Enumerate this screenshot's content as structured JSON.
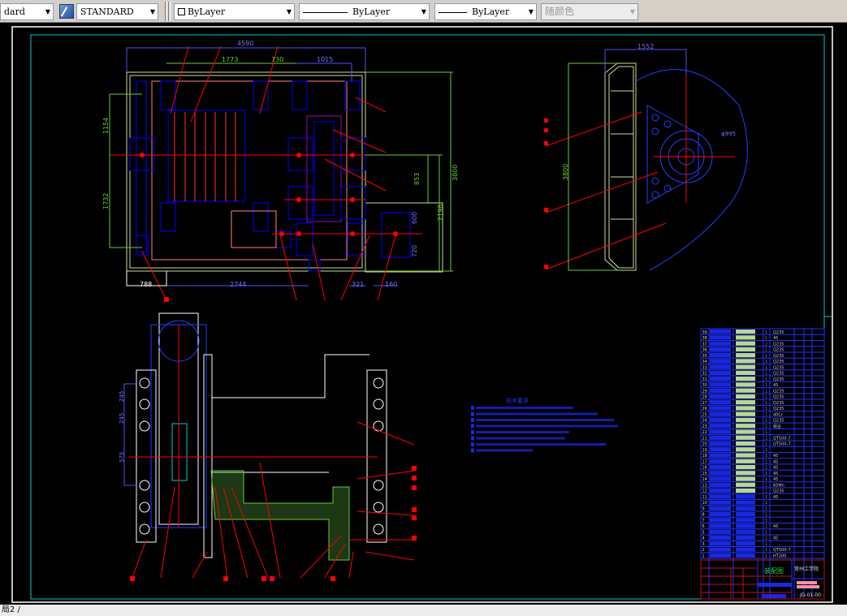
{
  "toolbar": {
    "text_style": "dard",
    "dim_style": "STANDARD",
    "layer": "ByLayer",
    "linetype": "ByLayer",
    "lineweight": "ByLayer",
    "plot_style": "随颜色",
    "dim_style_icon": "dimension-style-icon"
  },
  "status": {
    "layout_tab": "局2 /"
  },
  "colors": {
    "background": "#000000",
    "frame": "#ffffff",
    "border": "#00c8c8",
    "outline": "#0000ff",
    "centerline": "#ff0000",
    "dimension": "#66cc33",
    "light": "#ccdd99"
  },
  "drawing": {
    "top_view_dims": {
      "overall_width": "4590",
      "d1": "1773",
      "d2": "730",
      "d3": "1015",
      "left_h1": "1154",
      "left_h2": "1732",
      "right_h1": "853",
      "right_h2": "2198",
      "right_h3": "3800",
      "motor_h1": "600",
      "motor_h2": "720",
      "bottom1": "788",
      "bottom2": "2744",
      "bottom3": "321",
      "bottom4": "160"
    },
    "side_view_dims": {
      "width": "1552",
      "height": "3800",
      "diameter": "φ995"
    },
    "front_view_dims": {
      "a": "245",
      "b": "245",
      "c": "575"
    },
    "notes": {
      "title": "技术要求",
      "line_count": 8
    }
  },
  "parts_list": [
    {
      "no": "39",
      "qty": "1",
      "material": "Q235"
    },
    {
      "no": "38",
      "qty": "1",
      "material": "45"
    },
    {
      "no": "37",
      "qty": "2",
      "material": "Q235"
    },
    {
      "no": "36",
      "qty": "1",
      "material": "Q235"
    },
    {
      "no": "35",
      "qty": "1",
      "material": "Q235"
    },
    {
      "no": "34",
      "qty": "1",
      "material": "Q235"
    },
    {
      "no": "33",
      "qty": "1",
      "material": "Q235"
    },
    {
      "no": "32",
      "qty": "1",
      "material": "Q235"
    },
    {
      "no": "31",
      "qty": "1",
      "material": "Q235"
    },
    {
      "no": "30",
      "qty": "1",
      "material": "45"
    },
    {
      "no": "29",
      "qty": "1",
      "material": "Q235"
    },
    {
      "no": "28",
      "qty": "1",
      "material": "Q235"
    },
    {
      "no": "27",
      "qty": "1",
      "material": "Q235"
    },
    {
      "no": "26",
      "qty": "1",
      "material": "Q235"
    },
    {
      "no": "25",
      "qty": "1",
      "material": "40Cr"
    },
    {
      "no": "24",
      "qty": "1",
      "material": "Q235"
    },
    {
      "no": "23",
      "qty": "1",
      "material": "组合"
    },
    {
      "no": "22",
      "qty": "1",
      "material": ""
    },
    {
      "no": "21",
      "qty": "1",
      "material": "QT500-7"
    },
    {
      "no": "20",
      "qty": "1",
      "material": "QT500-7"
    },
    {
      "no": "19",
      "qty": "1",
      "material": ""
    },
    {
      "no": "18",
      "qty": "1",
      "material": "45"
    },
    {
      "no": "17",
      "qty": "1",
      "material": "45"
    },
    {
      "no": "16",
      "qty": "1",
      "material": "45"
    },
    {
      "no": "15",
      "qty": "1",
      "material": "45"
    },
    {
      "no": "14",
      "qty": "1",
      "material": "45"
    },
    {
      "no": "13",
      "qty": "1",
      "material": "65Mn"
    },
    {
      "no": "12",
      "qty": "1",
      "material": "Q235"
    },
    {
      "no": "11",
      "qty": "1",
      "material": "45"
    },
    {
      "no": "10",
      "qty": "1",
      "material": ""
    },
    {
      "no": "9",
      "qty": "1",
      "material": ""
    },
    {
      "no": "8",
      "qty": "1",
      "material": ""
    },
    {
      "no": "7",
      "qty": "1",
      "material": ""
    },
    {
      "no": "6",
      "qty": "1",
      "material": "45"
    },
    {
      "no": "5",
      "qty": "1",
      "material": ""
    },
    {
      "no": "4",
      "qty": "1",
      "material": "45"
    },
    {
      "no": "3",
      "qty": "1",
      "material": ""
    },
    {
      "no": "2",
      "qty": "1",
      "material": "QT500-7"
    },
    {
      "no": "1",
      "qty": "1",
      "material": "HT200"
    }
  ],
  "title_block": {
    "title": "装配图",
    "school": "常州工学院",
    "drawing_no": "JD-01-00"
  }
}
